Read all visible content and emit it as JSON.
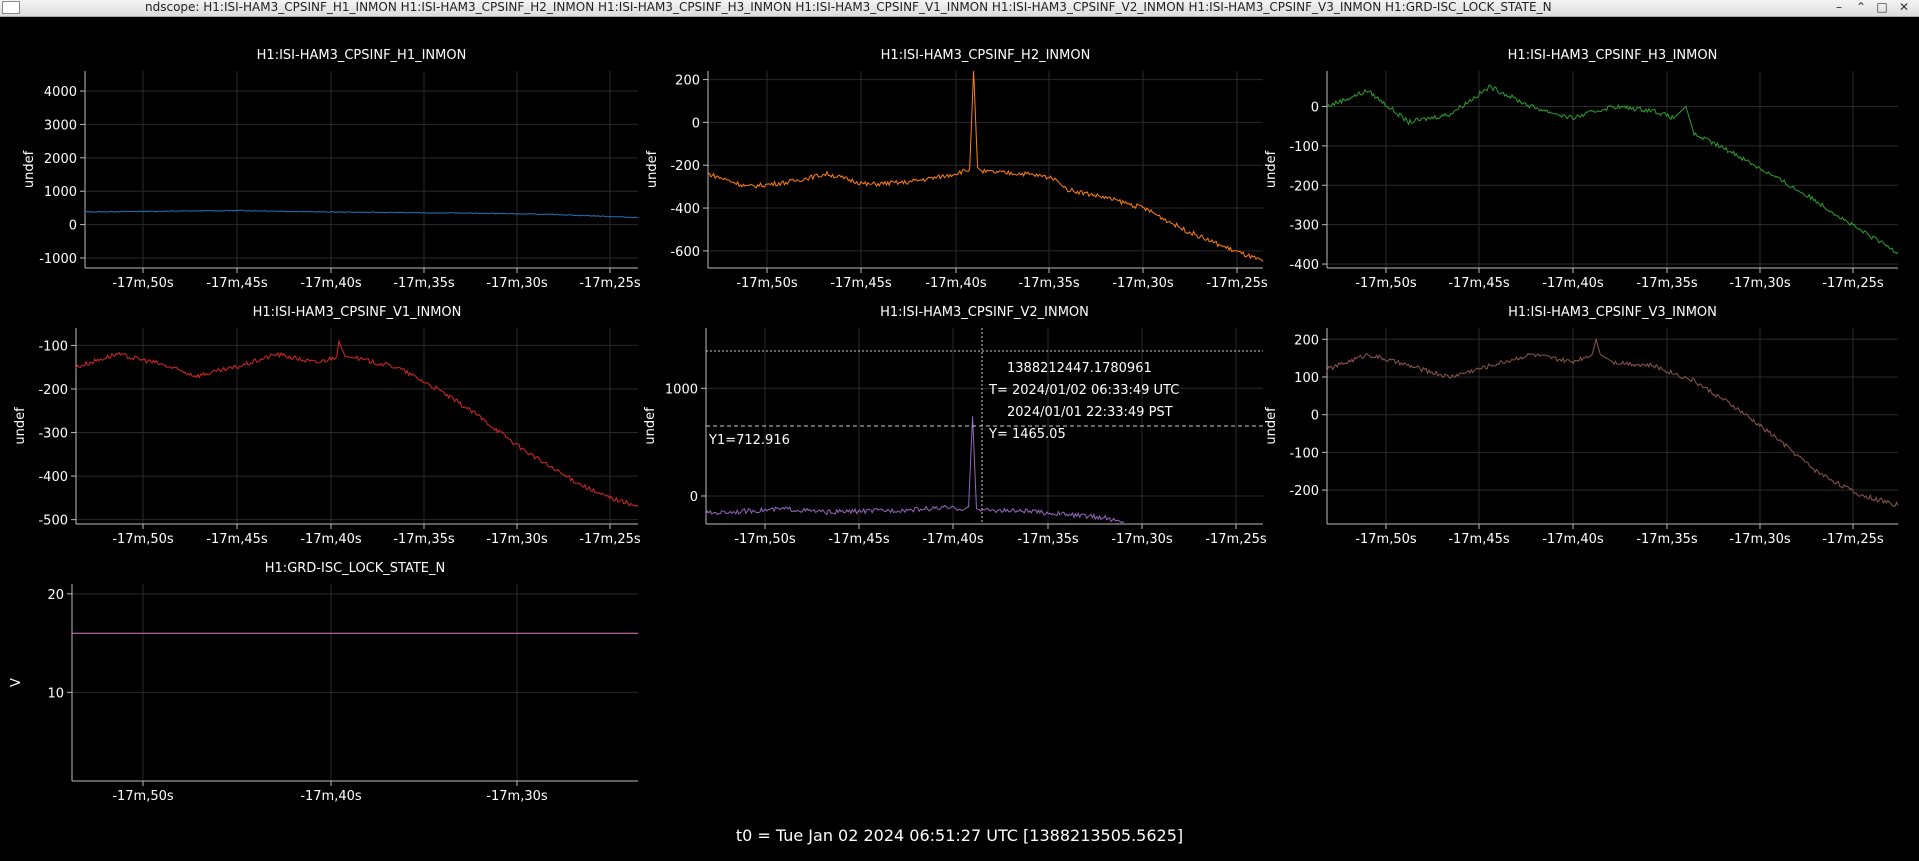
{
  "window": {
    "title": "ndscope: H1:ISI-HAM3_CPSINF_H1_INMON H1:ISI-HAM3_CPSINF_H2_INMON H1:ISI-HAM3_CPSINF_H3_INMON H1:ISI-HAM3_CPSINF_V1_INMON H1:ISI-HAM3_CPSINF_V2_INMON H1:ISI-HAM3_CPSINF_V3_INMON H1:GRD-ISC_LOCK_STATE_N",
    "minimize_glyph": "–",
    "restore_glyph": "⌃",
    "maximize_glyph": "□",
    "close_glyph": "✕"
  },
  "footer": {
    "t0_label": "t0 = Tue Jan 02 2024 06:51:27 UTC [1388213505.5625]"
  },
  "cursor_info": {
    "gps": "1388212447.1780961",
    "utc": "T= 2024/01/02 06:33:49 UTC",
    "local": "2024/01/01 22:33:49 PST",
    "y1_label": "Y1=712.916",
    "y_label": "Y= 1465.05"
  },
  "chart_data": [
    {
      "type": "line",
      "title": "H1:ISI-HAM3_CPSINF_H1_INMON",
      "ylabel": "undef",
      "color": "#1f77b4",
      "x_ticks": [
        "-17m,50s",
        "-17m,45s",
        "-17m,40s",
        "-17m,35s",
        "-17m,30s",
        "-17m,25s"
      ],
      "y_ticks": [
        4000,
        3000,
        2000,
        1000,
        0,
        -1000
      ],
      "ylim": [
        -1300,
        4600
      ],
      "series": [
        {
          "x": [
            -1052,
            -1048,
            -1044,
            -1040,
            -1036,
            -1032,
            -1028,
            -1024
          ],
          "values": [
            380,
            400,
            420,
            380,
            360,
            340,
            300,
            210
          ]
        }
      ]
    },
    {
      "type": "line",
      "title": "H1:ISI-HAM3_CPSINF_H2_INMON",
      "ylabel": "undef",
      "color": "#ff7f0e",
      "x_ticks": [
        "-17m,50s",
        "-17m,45s",
        "-17m,40s",
        "-17m,35s",
        "-17m,30s",
        "-17m,25s"
      ],
      "y_ticks": [
        200,
        0,
        -200,
        -400,
        -600
      ],
      "ylim": [
        -680,
        240
      ],
      "series": [
        {
          "x": [
            -1052,
            -1050,
            -1048,
            -1046,
            -1044,
            -1042,
            -1040,
            -1038.8,
            -1038.6,
            -1038.4,
            -1038.2,
            -1036,
            -1034.5,
            -1034,
            -1032,
            -1030,
            -1028,
            -1026,
            -1024
          ],
          "values": [
            -240,
            -300,
            -280,
            -240,
            -290,
            -280,
            -250,
            -220,
            250,
            -210,
            -230,
            -240,
            -260,
            -310,
            -350,
            -400,
            -500,
            -580,
            -650
          ]
        }
      ]
    },
    {
      "type": "line",
      "title": "H1:ISI-HAM3_CPSINF_H3_INMON",
      "ylabel": "undef",
      "color": "#2ca02c",
      "x_ticks": [
        "-17m,50s",
        "-17m,45s",
        "-17m,40s",
        "-17m,35s",
        "-17m,30s",
        "-17m,25s"
      ],
      "y_ticks": [
        0,
        -100,
        -200,
        -300,
        -400
      ],
      "ylim": [
        -410,
        90
      ],
      "series": [
        {
          "x": [
            -1052,
            -1050,
            -1048,
            -1046,
            -1044,
            -1042,
            -1040,
            -1038,
            -1036,
            -1035,
            -1034.4,
            -1034,
            -1032,
            -1030,
            -1028,
            -1026,
            -1024
          ],
          "values": [
            0,
            40,
            -40,
            -20,
            50,
            0,
            -30,
            0,
            -10,
            -30,
            0,
            -70,
            -120,
            -180,
            -240,
            -310,
            -370
          ]
        }
      ]
    },
    {
      "type": "line",
      "title": "H1:ISI-HAM3_CPSINF_V1_INMON",
      "ylabel": "undef",
      "color": "#d62728",
      "x_ticks": [
        "-17m,50s",
        "-17m,45s",
        "-17m,40s",
        "-17m,35s",
        "-17m,30s",
        "-17m,25s"
      ],
      "y_ticks": [
        -100,
        -200,
        -300,
        -400,
        -500
      ],
      "ylim": [
        -510,
        -60
      ],
      "series": [
        {
          "x": [
            -1052,
            -1050,
            -1048,
            -1046,
            -1044,
            -1042,
            -1040,
            -1039,
            -1038.9,
            -1038.6,
            -1038,
            -1036,
            -1034,
            -1032,
            -1030,
            -1028,
            -1026,
            -1024
          ],
          "values": [
            -150,
            -120,
            -140,
            -170,
            -150,
            -120,
            -140,
            -125,
            -90,
            -125,
            -130,
            -150,
            -200,
            -260,
            -330,
            -390,
            -440,
            -470
          ]
        }
      ]
    },
    {
      "type": "line",
      "title": "H1:ISI-HAM3_CPSINF_V2_INMON",
      "ylabel": "undef",
      "color": "#9467bd",
      "x_ticks": [
        "-17m,50s",
        "-17m,45s",
        "-17m,40s",
        "-17m,35s",
        "-17m,30s",
        "-17m,25s"
      ],
      "y_ticks": [
        1000,
        0
      ],
      "ylim": [
        -260,
        1560
      ],
      "series": [
        {
          "x": [
            -1052,
            -1050,
            -1048,
            -1046,
            -1044,
            -1042,
            -1040,
            -1039,
            -1038.8,
            -1038.6,
            -1038.4,
            -1038.2,
            -1036,
            -1034,
            -1032,
            -1031
          ],
          "values": [
            -160,
            -140,
            -120,
            -150,
            -140,
            -130,
            -110,
            -120,
            -100,
            740,
            -120,
            -130,
            -140,
            -170,
            -200,
            -250
          ]
        }
      ]
    },
    {
      "type": "line",
      "title": "H1:ISI-HAM3_CPSINF_V3_INMON",
      "ylabel": "undef",
      "color": "#8c564b",
      "x_ticks": [
        "-17m,50s",
        "-17m,45s",
        "-17m,40s",
        "-17m,35s",
        "-17m,30s",
        "-17m,25s"
      ],
      "y_ticks": [
        200,
        100,
        0,
        -100,
        -200
      ],
      "ylim": [
        -290,
        230
      ],
      "series": [
        {
          "x": [
            -1052,
            -1050,
            -1048,
            -1046,
            -1044,
            -1042,
            -1040,
            -1039,
            -1038.8,
            -1038.6,
            -1038,
            -1036,
            -1034,
            -1032,
            -1030,
            -1028,
            -1026,
            -1024
          ],
          "values": [
            120,
            160,
            130,
            100,
            130,
            160,
            140,
            160,
            200,
            160,
            140,
            130,
            90,
            20,
            -60,
            -150,
            -210,
            -240
          ]
        }
      ]
    },
    {
      "type": "line",
      "title": "H1:GRD-ISC_LOCK_STATE_N",
      "ylabel": "V",
      "color": "#e377c2",
      "x_ticks": [
        "-17m,50s",
        "-17m,40s",
        "-17m,30s"
      ],
      "y_ticks": [
        20,
        10
      ],
      "ylim": [
        1,
        21
      ],
      "series": [
        {
          "x": [
            -1052,
            -1024
          ],
          "values": [
            16,
            16
          ]
        }
      ]
    }
  ]
}
